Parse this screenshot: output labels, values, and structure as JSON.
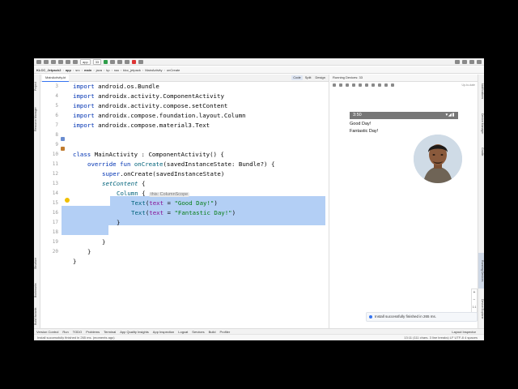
{
  "toolbar": {
    "run_config": "app",
    "device": "33"
  },
  "breadcrumb": [
    "KLCC_Jetpack2",
    "app",
    "src",
    "main",
    "java",
    "kp",
    "raa",
    "klcc_jetpack",
    "MainActivity",
    "onCreate"
  ],
  "editor": {
    "tab": "MainActivity.kt",
    "modes": [
      "Code",
      "Split",
      "Design"
    ],
    "line_numbers": [
      "3",
      "4",
      "5",
      "6",
      "7",
      "8",
      "9",
      "10",
      "11",
      "12",
      "13",
      "14",
      "15",
      "16",
      "17",
      "18",
      "19",
      "20"
    ],
    "lines": {
      "l3": {
        "kw": "import ",
        "rest": "android.os.Bundle"
      },
      "l4": {
        "kw": "import ",
        "rest": "androidx.activity.ComponentActivity"
      },
      "l5": {
        "kw": "import ",
        "rest": "androidx.activity.compose.setContent"
      },
      "l6": {
        "kw": "import ",
        "rest": "androidx.compose.foundation.layout.Column"
      },
      "l7": {
        "kw": "import ",
        "rest": "androidx.compose.material3.Text"
      },
      "l9": {
        "kw": "class ",
        "rest": "MainActivity : ComponentActivity() {"
      },
      "l10": {
        "kw": "override fun ",
        "fn": "onCreate",
        "rest": "(savedInstanceState: Bundle?) {"
      },
      "l11": {
        "kw": "super",
        "rest": ".onCreate(savedInstanceState)"
      },
      "l12": {
        "fn": "setContent",
        "rest": " {"
      },
      "l13": {
        "fn": "Column",
        "rest": " {",
        "hint": "this: ColumnScope"
      },
      "l14": {
        "fn": "Text",
        "open": "(",
        "param": "text",
        "eq": " = ",
        "str": "\"Good Day!\"",
        "close": ")"
      },
      "l15": {
        "fn": "Text",
        "open": "(",
        "param": "text",
        "eq": " = ",
        "str": "\"Fantastic Day!\"",
        "close": ")"
      },
      "l16": {
        "rest": "}"
      },
      "l18": {
        "rest": "}"
      },
      "l19": {
        "rest": "}"
      },
      "l20": {
        "rest": "}"
      }
    }
  },
  "emulator": {
    "title": "Running Devices:",
    "device": "33",
    "status": "Up-to-date",
    "time": "3:50",
    "status_icons": "▾◢▮",
    "texts": [
      "Good Day!",
      "Fantastic Day!"
    ],
    "zoom": [
      "+",
      "−",
      "1:1"
    ],
    "toast": "Install successfully finished in 265 ms."
  },
  "left_tools": [
    "Project",
    "Resource Manager",
    "Structure",
    "Bookmarks",
    "Build Variants"
  ],
  "right_tools": [
    "Notifications",
    "Device Manager",
    "Gradle",
    "Running Devices",
    "Device Explorer"
  ],
  "bottom_tools": [
    "Version Control",
    "Run",
    "TODO",
    "Problems",
    "Terminal",
    "App Quality Insights",
    "App Inspection",
    "Logcat",
    "Services",
    "Build",
    "Profiler"
  ],
  "layout_inspector": "Layout Inspector",
  "status": {
    "message": "Install successfully finished in 265 ms. (moments ago)",
    "right": "13:11 (111 chars, 3 line breaks)   LF   UTF-8   4 spaces"
  },
  "colors": {
    "selection": "#b3cff5",
    "keyword": "#0033b3",
    "function": "#00627a",
    "string": "#067d17",
    "param": "#871094"
  }
}
